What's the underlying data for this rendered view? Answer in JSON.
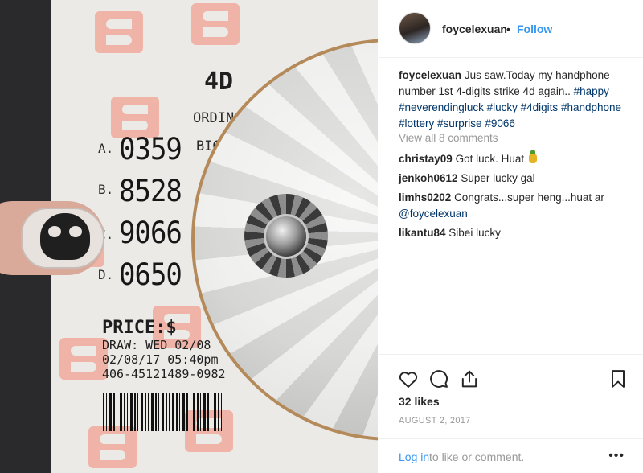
{
  "ticket": {
    "title": "4D",
    "bet_type": "ORDINA",
    "rows": [
      {
        "letter": "A.",
        "number": "0359",
        "tag": "BIG"
      },
      {
        "letter": "B.",
        "number": "8528",
        "tag": ""
      },
      {
        "letter": "C.",
        "number": "9066",
        "tag": ""
      },
      {
        "letter": "D.",
        "number": "0650",
        "tag": ""
      }
    ],
    "price": "PRICE:$",
    "draw_line": "DRAW: WED 02/08",
    "date_line": "02/08/17 05:40pm",
    "serial_line": "406-45121489-0982"
  },
  "post": {
    "username": "foycelexuan",
    "dot": "•",
    "follow_label": "Follow",
    "caption_user": "foycelexuan",
    "caption_text": "Jus saw.Today my handphone number 1st 4-digits strike 4d again..",
    "hashtags": [
      "#happy",
      "#neverendingluck",
      "#lucky",
      "#4digits",
      "#handphone",
      "#lottery",
      "#surprise",
      "#9066"
    ],
    "view_all": "View all 8 comments",
    "comments": [
      {
        "user": "christay09",
        "text": "Got luck. Huat",
        "emoji": "pineapple-icon"
      },
      {
        "user": "jenkoh0612",
        "text": "Super lucky gal"
      },
      {
        "user": "limhs0202",
        "text": "Congrats...super heng...huat ar",
        "mention": "@foycelexuan"
      },
      {
        "user": "likantu84",
        "text": "Sibei lucky"
      }
    ],
    "likes": "32 likes",
    "date": "AUGUST 2, 2017",
    "login_label": "Log in",
    "login_rest": "to like or comment.",
    "more_label": "•••"
  },
  "icons": [
    "heart-icon",
    "comment-icon",
    "share-icon",
    "bookmark-icon"
  ]
}
